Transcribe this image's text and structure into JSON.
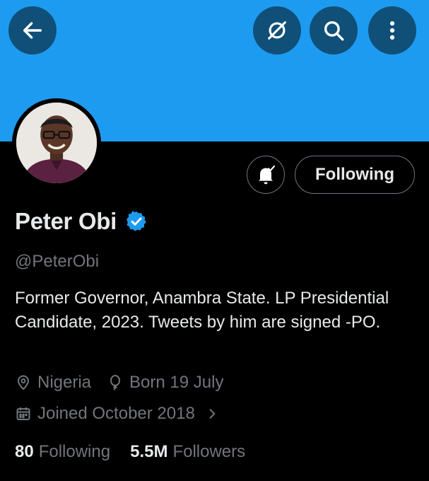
{
  "profile": {
    "display_name": "Peter Obi",
    "handle": "@PeterObi",
    "bio": "Former Governor, Anambra State. LP Presidential Candidate, 2023. Tweets by him are signed -PO.",
    "location": "Nigeria",
    "birthday": "Born 19 July",
    "joined": "Joined October 2018",
    "following_count": "80",
    "following_label": "Following",
    "followers_count": "5.5M",
    "followers_label": "Followers",
    "verified": true
  },
  "actions": {
    "following_button_label": "Following"
  },
  "icons": {
    "back": "arrow-left-icon",
    "translate": "translate-icon",
    "search": "search-icon",
    "more": "more-vertical-icon",
    "notify": "bell-check-icon",
    "verified": "verified-badge-icon",
    "location": "location-pin-icon",
    "birthday": "balloon-icon",
    "joined": "calendar-icon",
    "chevron": "chevron-right-icon"
  },
  "colors": {
    "banner": "#1d9bf0",
    "background": "#000000",
    "accent": "#1d9bf0",
    "muted_text": "#71767b",
    "primary_text": "#e7e9ea"
  }
}
